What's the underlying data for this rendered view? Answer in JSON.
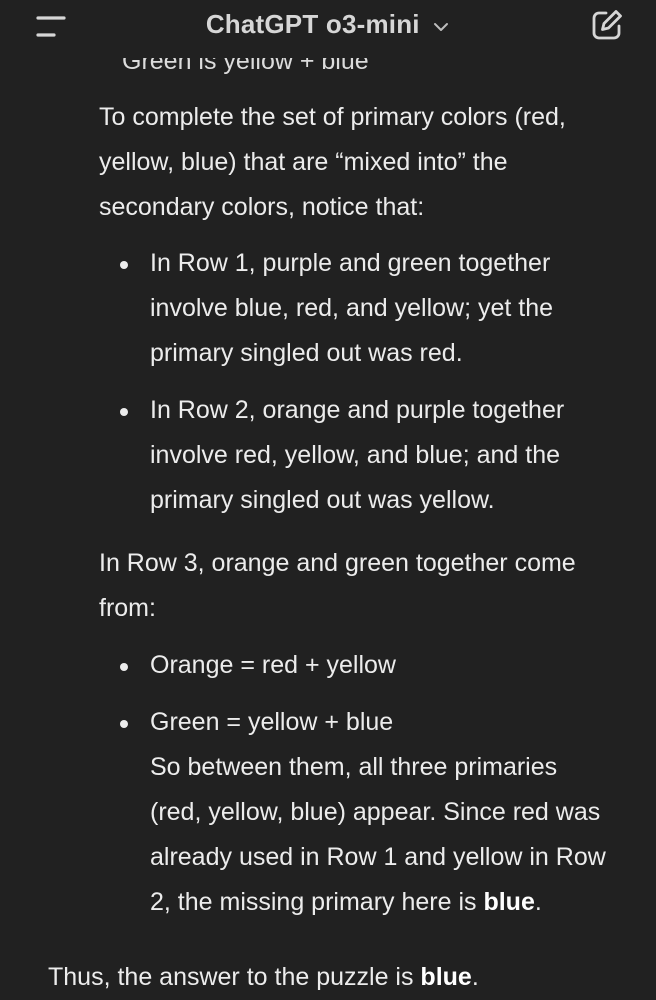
{
  "header": {
    "title": "ChatGPT o3-mini",
    "menu_icon": "menu-icon",
    "chevron_icon": "chevron-down-icon",
    "edit_icon": "new-chat-edit-icon"
  },
  "message": {
    "clipped_line": "Green is yellow + blue",
    "intro": [
      "To complete the set of primary colors (red,",
      "yellow, blue) that are “mixed into” the",
      "secondary colors, notice that:"
    ],
    "row_bullets": [
      {
        "lines": [
          "In Row 1, purple and green together",
          "involve blue, red, and yellow; yet the",
          "primary singled out was red."
        ]
      },
      {
        "lines": [
          "In Row 2, orange and purple together",
          "involve red, yellow, and blue; and the",
          "primary singled out was yellow."
        ]
      }
    ],
    "row3_intro": [
      "In Row 3, orange and green together come",
      "from:"
    ],
    "mix_bullets": [
      {
        "lines": [
          "Orange = red + yellow"
        ]
      },
      {
        "lines": [
          "Green = yellow + blue",
          "So between them, all three primaries",
          "(red, yellow, blue) appear. Since red was",
          "already used in Row 1 and yellow in Row",
          "2, the missing primary here is "
        ],
        "bold_end": "blue",
        "trail": "."
      }
    ],
    "conclusion": {
      "prefix": "Thus, the answer to the puzzle is ",
      "bold": "blue",
      "suffix": "."
    }
  },
  "colors": {
    "background": "#212121",
    "text": "#ececec",
    "header_text": "#d6d6d6"
  }
}
